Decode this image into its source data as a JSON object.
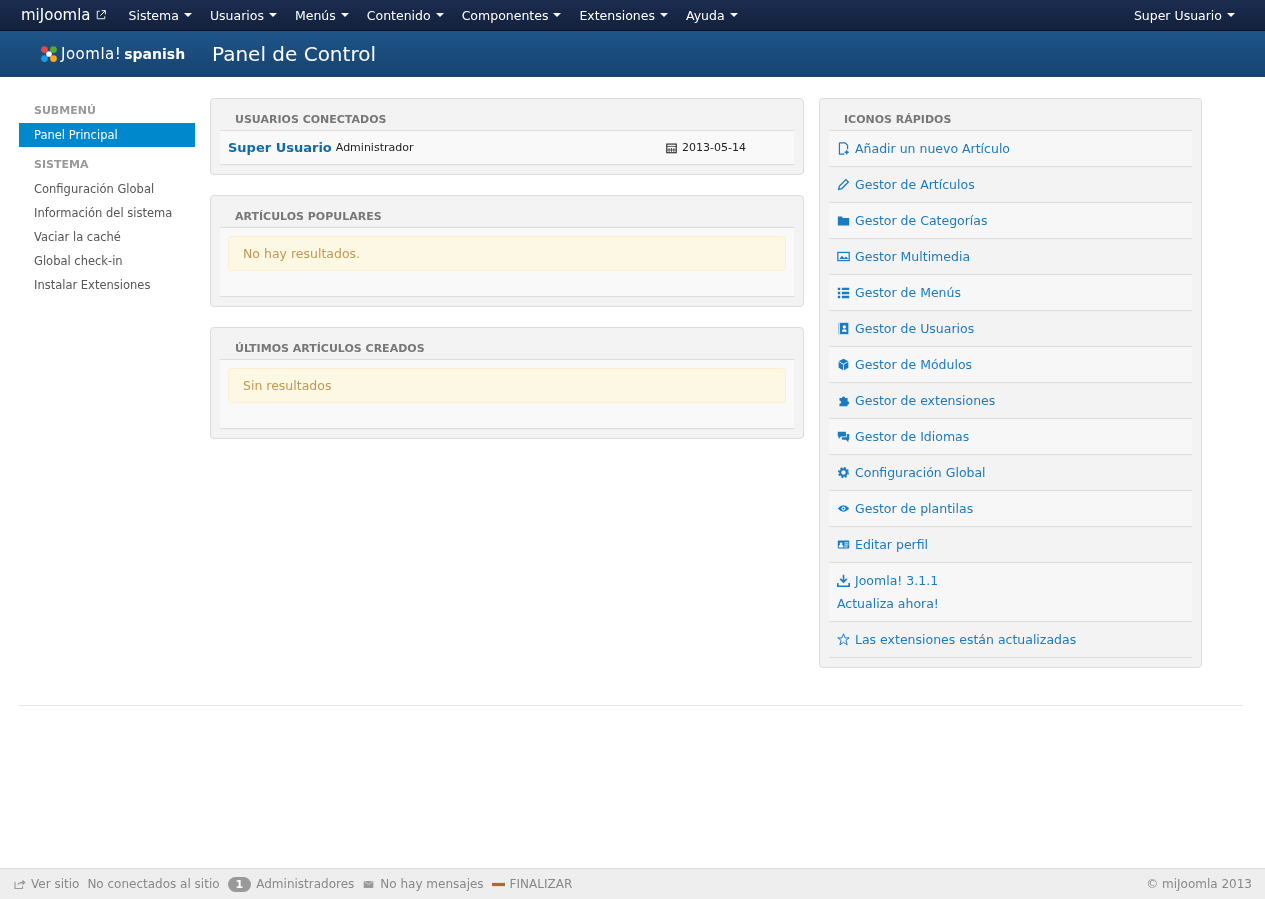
{
  "navbar": {
    "brand": "miJoomla",
    "menus": [
      {
        "label": "Sistema"
      },
      {
        "label": "Usuarios"
      },
      {
        "label": "Menús"
      },
      {
        "label": "Contenido"
      },
      {
        "label": "Componentes"
      },
      {
        "label": "Extensiones"
      },
      {
        "label": "Ayuda"
      }
    ],
    "user_menu": "Super Usuario"
  },
  "header": {
    "logo": "Joomla!",
    "logo_suffix": "spanish",
    "title": "Panel de Control"
  },
  "sidebar": {
    "sections": [
      {
        "heading": "SUBMENÚ",
        "items": [
          {
            "label": "Panel Principal",
            "selected": true
          }
        ]
      },
      {
        "heading": "SISTEMA",
        "items": [
          {
            "label": "Configuración Global",
            "selected": false
          },
          {
            "label": "Información del sistema",
            "selected": false
          },
          {
            "label": "Vaciar la caché",
            "selected": false
          },
          {
            "label": "Global check-in",
            "selected": false
          },
          {
            "label": "Instalar Extensiones",
            "selected": false
          }
        ]
      }
    ]
  },
  "modules": [
    {
      "title": "USUARIOS CONECTADOS",
      "kind": "users",
      "rows": [
        {
          "name": "Super Usuario",
          "role": "Administrador",
          "date": "2013-05-14"
        }
      ]
    },
    {
      "title": "ARTÍCULOS POPULARES",
      "kind": "message",
      "message": "No hay resultados."
    },
    {
      "title": "ÚLTIMOS ARTÍCULOS CREADOS",
      "kind": "message",
      "message": "Sin resultados"
    }
  ],
  "quick_icons": {
    "title": "ICONOS RÁPIDOS",
    "items": [
      {
        "label": "Añadir un nuevo Artículo"
      },
      {
        "label": "Gestor de Artículos"
      },
      {
        "label": "Gestor de Categorías"
      },
      {
        "label": "Gestor Multimedia"
      },
      {
        "label": "Gestor de Menús"
      },
      {
        "label": "Gestor de Usuarios"
      },
      {
        "label": "Gestor de Módulos"
      },
      {
        "label": "Gestor de extensiones"
      },
      {
        "label": "Gestor de Idiomas"
      },
      {
        "label": "Configuración Global"
      },
      {
        "label": "Gestor de plantilas"
      },
      {
        "label": "Editar perfil"
      },
      {
        "label": "Joomla! 3.1.1",
        "note": "Actualiza ahora!"
      },
      {
        "label": "Las extensiones están actualizadas"
      }
    ]
  },
  "status_bar": {
    "view_site": "Ver sitio",
    "visitors": "No conectados al sitio",
    "admin_count": "1",
    "admins": "Administradores",
    "messages": "No hay mensajes",
    "logout": "FINALIZAR",
    "copyright": "© miJoomla 2013"
  }
}
